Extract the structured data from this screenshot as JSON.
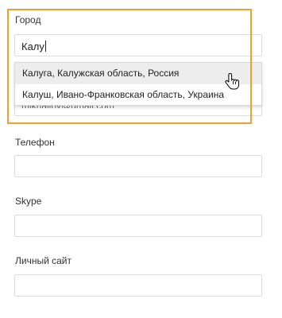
{
  "city": {
    "label": "Город",
    "value": "Калу"
  },
  "suggestions": [
    "Калуга, Калужская область, Россия",
    "Калуш, Ивано-Франковская область, Украина"
  ],
  "email": {
    "value": "mikhailov@gmail.com"
  },
  "phone": {
    "label": "Телефон",
    "value": ""
  },
  "skype": {
    "label": "Skype",
    "value": ""
  },
  "website": {
    "label": "Личный сайт",
    "value": ""
  },
  "colors": {
    "focus_outline": "#f0a030",
    "highlight_row": "#ededed",
    "border": "#dcdcdc"
  },
  "icons": {
    "cursor": "hand-pointer-icon"
  }
}
